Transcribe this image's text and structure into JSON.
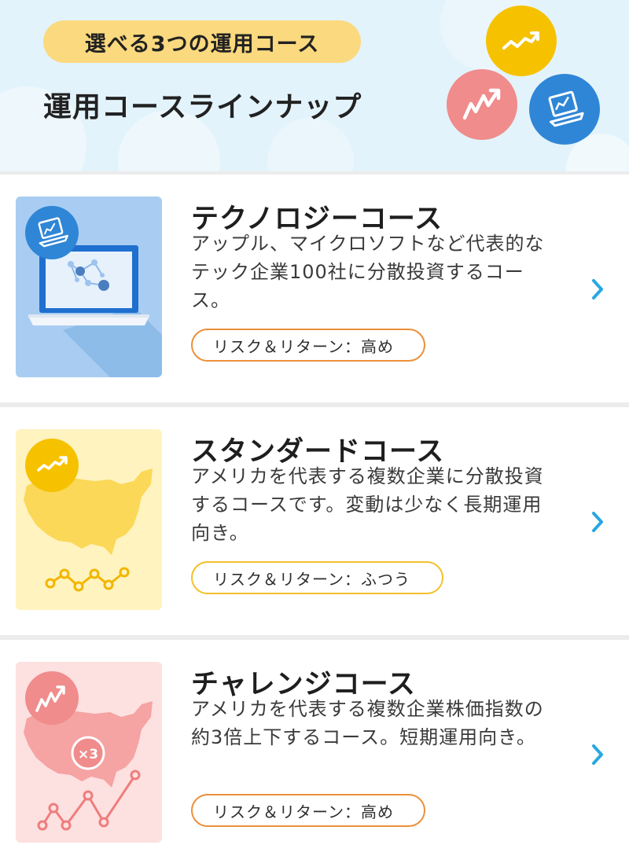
{
  "header": {
    "tag_label": "選べる3つの運用コース",
    "title": "運用コースラインナップ",
    "icons": [
      "chart-up-yellow-icon",
      "chart-up-red-icon",
      "laptop-blue-icon"
    ],
    "colors": {
      "background": "#e3f3fb",
      "tag": "#fbd97e",
      "yellow": "#f6c200",
      "red": "#f08c8c",
      "blue": "#2f86d6"
    }
  },
  "courses": [
    {
      "title": "テクノロジーコース",
      "description": "アップル、マイクロソフトなど代表的なテック企業100社に分散投資するコース。",
      "risk_label": "リスク＆リターン：高め",
      "thumbnail": "laptop-network-illustration",
      "accent": "#2f86d6",
      "badge_border": "#ec8f3a"
    },
    {
      "title": "スタンダードコース",
      "description": "アメリカを代表する複数企業に分散投資するコースです。変動は少なく長期運用向き。",
      "risk_label": "リスク＆リターン：ふつう",
      "thumbnail": "usa-map-steady-line-illustration",
      "accent": "#f6c200",
      "badge_border": "#f3c02c"
    },
    {
      "title": "チャレンジコース",
      "description": "アメリカを代表する複数企業株価指数の約3倍上下するコース。短期運用向き。",
      "risk_label": "リスク＆リターン：高め",
      "thumbnail": "usa-map-volatile-line-illustration",
      "thumb_badge": "×3",
      "accent": "#f08c8c",
      "badge_border": "#ec8f3a"
    }
  ],
  "chevron_color": "#29a7e1"
}
